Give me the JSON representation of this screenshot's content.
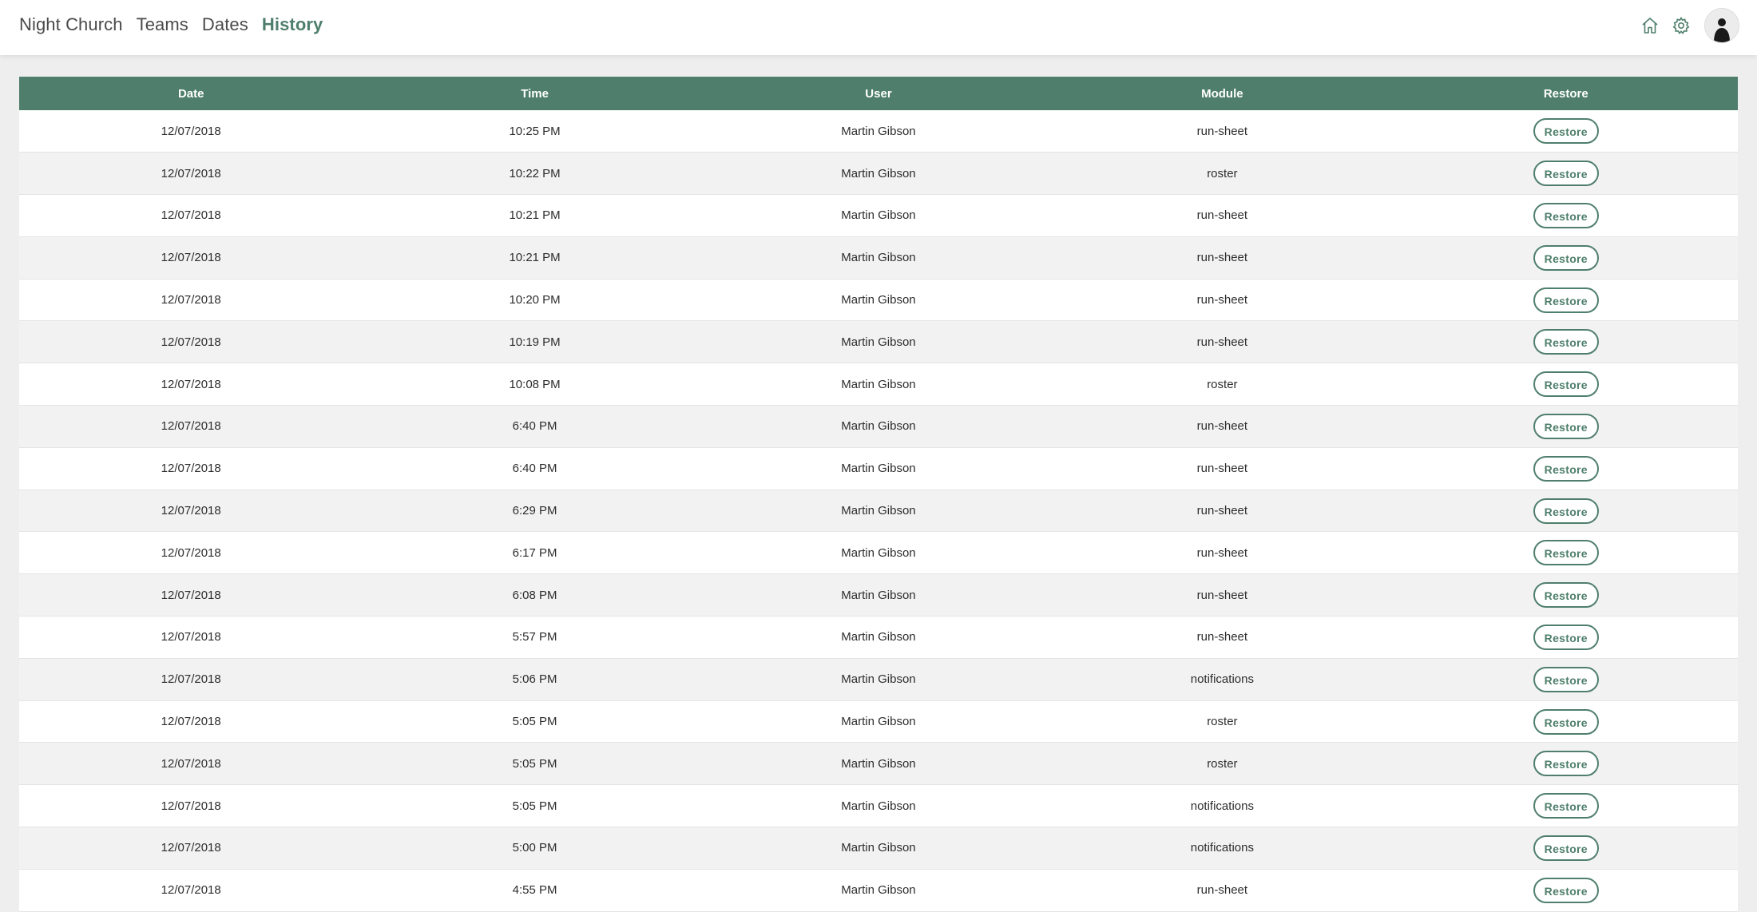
{
  "nav": {
    "items": [
      {
        "label": "Night Church",
        "active": false
      },
      {
        "label": "Teams",
        "active": false
      },
      {
        "label": "Dates",
        "active": false
      },
      {
        "label": "History",
        "active": true
      }
    ]
  },
  "header_icons": [
    "home-icon",
    "gear-icon",
    "avatar"
  ],
  "colors": {
    "accent": "#4f7f6c",
    "header_bg": "#4f7f6c",
    "row_alt": "#f2f2f2",
    "page_bg": "#eeeeee"
  },
  "table": {
    "columns": [
      "Date",
      "Time",
      "User",
      "Module",
      "Restore"
    ],
    "restore_label": "Restore",
    "rows": [
      {
        "date": "12/07/2018",
        "time": "10:25 PM",
        "user": "Martin Gibson",
        "module": "run-sheet"
      },
      {
        "date": "12/07/2018",
        "time": "10:22 PM",
        "user": "Martin Gibson",
        "module": "roster"
      },
      {
        "date": "12/07/2018",
        "time": "10:21 PM",
        "user": "Martin Gibson",
        "module": "run-sheet"
      },
      {
        "date": "12/07/2018",
        "time": "10:21 PM",
        "user": "Martin Gibson",
        "module": "run-sheet"
      },
      {
        "date": "12/07/2018",
        "time": "10:20 PM",
        "user": "Martin Gibson",
        "module": "run-sheet"
      },
      {
        "date": "12/07/2018",
        "time": "10:19 PM",
        "user": "Martin Gibson",
        "module": "run-sheet"
      },
      {
        "date": "12/07/2018",
        "time": "10:08 PM",
        "user": "Martin Gibson",
        "module": "roster"
      },
      {
        "date": "12/07/2018",
        "time": "6:40 PM",
        "user": "Martin Gibson",
        "module": "run-sheet"
      },
      {
        "date": "12/07/2018",
        "time": "6:40 PM",
        "user": "Martin Gibson",
        "module": "run-sheet"
      },
      {
        "date": "12/07/2018",
        "time": "6:29 PM",
        "user": "Martin Gibson",
        "module": "run-sheet"
      },
      {
        "date": "12/07/2018",
        "time": "6:17 PM",
        "user": "Martin Gibson",
        "module": "run-sheet"
      },
      {
        "date": "12/07/2018",
        "time": "6:08 PM",
        "user": "Martin Gibson",
        "module": "run-sheet"
      },
      {
        "date": "12/07/2018",
        "time": "5:57 PM",
        "user": "Martin Gibson",
        "module": "run-sheet"
      },
      {
        "date": "12/07/2018",
        "time": "5:06 PM",
        "user": "Martin Gibson",
        "module": "notifications"
      },
      {
        "date": "12/07/2018",
        "time": "5:05 PM",
        "user": "Martin Gibson",
        "module": "roster"
      },
      {
        "date": "12/07/2018",
        "time": "5:05 PM",
        "user": "Martin Gibson",
        "module": "roster"
      },
      {
        "date": "12/07/2018",
        "time": "5:05 PM",
        "user": "Martin Gibson",
        "module": "notifications"
      },
      {
        "date": "12/07/2018",
        "time": "5:00 PM",
        "user": "Martin Gibson",
        "module": "notifications"
      },
      {
        "date": "12/07/2018",
        "time": "4:55 PM",
        "user": "Martin Gibson",
        "module": "run-sheet"
      }
    ]
  }
}
